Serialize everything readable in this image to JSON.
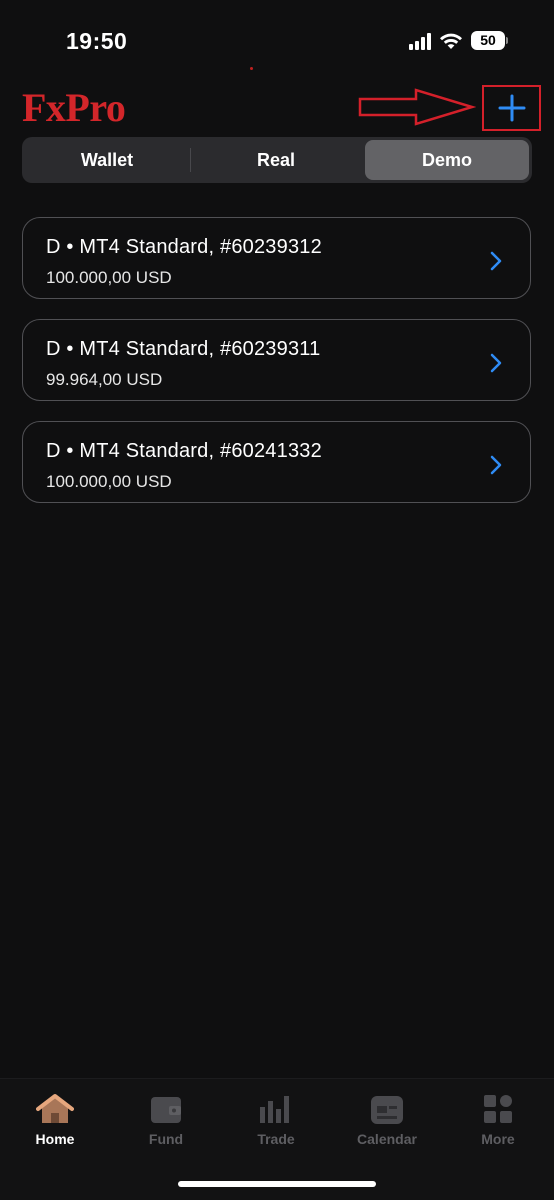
{
  "status_bar": {
    "time": "19:50",
    "battery": "50",
    "icons": [
      "signal-icon",
      "wifi-icon",
      "battery-icon"
    ]
  },
  "header": {
    "logo": "FxPro",
    "add_button_icon": "plus-icon",
    "annotation_icon": "arrow-right-icon"
  },
  "segments": {
    "items": [
      {
        "label": "Wallet",
        "selected": false
      },
      {
        "label": "Real",
        "selected": false
      },
      {
        "label": "Demo",
        "selected": true
      }
    ]
  },
  "accounts": [
    {
      "title": "D • MT4 Standard, #60239312",
      "balance": "100.000,00 USD"
    },
    {
      "title": "D • MT4 Standard, #60239311",
      "balance": "99.964,00 USD"
    },
    {
      "title": "D • MT4 Standard, #60241332",
      "balance": "100.000,00 USD"
    }
  ],
  "tab_bar": {
    "items": [
      {
        "label": "Home",
        "icon": "home-icon",
        "active": true
      },
      {
        "label": "Fund",
        "icon": "wallet-icon",
        "active": false
      },
      {
        "label": "Trade",
        "icon": "bar-chart-icon",
        "active": false
      },
      {
        "label": "Calendar",
        "icon": "calendar-icon",
        "active": false
      },
      {
        "label": "More",
        "icon": "grid-icon",
        "active": false
      }
    ]
  },
  "colors": {
    "background": "#0f0f10",
    "brand_red": "#d3262a",
    "accent_blue": "#2f8cf5",
    "selected_segment": "#636366",
    "active_tab_icon": "#d9a07a"
  }
}
